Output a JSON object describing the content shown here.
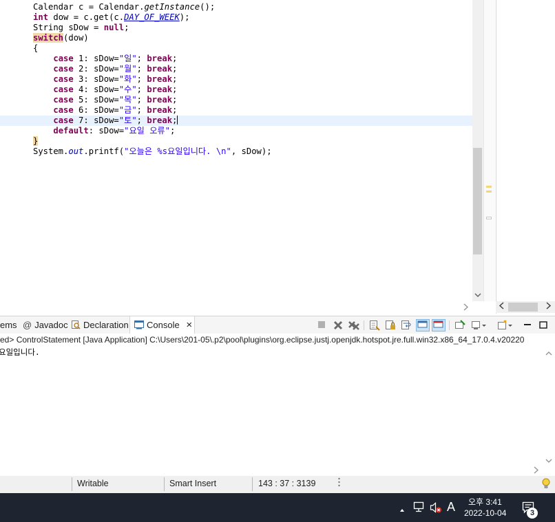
{
  "editor": {
    "lines": [
      {
        "indent": "",
        "tokens": [
          {
            "t": "Calendar c = Calendar."
          },
          {
            "t": "getInstance",
            "c": "it"
          },
          {
            "t": "();"
          }
        ]
      },
      {
        "indent": "",
        "tokens": [
          {
            "t": "int",
            "c": "kw"
          },
          {
            "t": " dow = c.get(c."
          },
          {
            "t": "DAY_OF_WEEK",
            "c": "sf ul"
          },
          {
            "t": ");"
          }
        ]
      },
      {
        "indent": "",
        "tokens": [
          {
            "t": "String sDow = "
          },
          {
            "t": "null",
            "c": "kw"
          },
          {
            "t": ";"
          }
        ]
      },
      {
        "indent": "",
        "tokens": [
          {
            "t": "switch",
            "c": "kw hl"
          },
          {
            "t": "(dow)"
          }
        ]
      },
      {
        "indent": "",
        "tokens": [
          {
            "t": "{"
          }
        ]
      },
      {
        "indent": "    ",
        "tokens": [
          {
            "t": "case",
            "c": "kw"
          },
          {
            "t": " 1: sDow="
          },
          {
            "t": "\"일\"",
            "c": "str"
          },
          {
            "t": "; "
          },
          {
            "t": "break",
            "c": "kw"
          },
          {
            "t": ";"
          }
        ]
      },
      {
        "indent": "    ",
        "tokens": [
          {
            "t": "case",
            "c": "kw"
          },
          {
            "t": " 2: sDow="
          },
          {
            "t": "\"월\"",
            "c": "str"
          },
          {
            "t": "; "
          },
          {
            "t": "break",
            "c": "kw"
          },
          {
            "t": ";"
          }
        ]
      },
      {
        "indent": "    ",
        "tokens": [
          {
            "t": "case",
            "c": "kw"
          },
          {
            "t": " 3: sDow="
          },
          {
            "t": "\"화\"",
            "c": "str"
          },
          {
            "t": "; "
          },
          {
            "t": "break",
            "c": "kw"
          },
          {
            "t": ";"
          }
        ]
      },
      {
        "indent": "    ",
        "tokens": [
          {
            "t": "case",
            "c": "kw"
          },
          {
            "t": " 4: sDow="
          },
          {
            "t": "\"수\"",
            "c": "str"
          },
          {
            "t": "; "
          },
          {
            "t": "break",
            "c": "kw"
          },
          {
            "t": ";"
          }
        ]
      },
      {
        "indent": "    ",
        "tokens": [
          {
            "t": "case",
            "c": "kw"
          },
          {
            "t": " 5: sDow="
          },
          {
            "t": "\"목\"",
            "c": "str"
          },
          {
            "t": "; "
          },
          {
            "t": "break",
            "c": "kw"
          },
          {
            "t": ";"
          }
        ]
      },
      {
        "indent": "    ",
        "tokens": [
          {
            "t": "case",
            "c": "kw"
          },
          {
            "t": " 6: sDow="
          },
          {
            "t": "\"금\"",
            "c": "str"
          },
          {
            "t": "; "
          },
          {
            "t": "break",
            "c": "kw"
          },
          {
            "t": ";"
          }
        ]
      },
      {
        "indent": "    ",
        "tokens": [
          {
            "t": "case",
            "c": "kw"
          },
          {
            "t": " 7: sDow="
          },
          {
            "t": "\"토\"",
            "c": "str"
          },
          {
            "t": "; "
          },
          {
            "t": "break",
            "c": "kw"
          },
          {
            "t": ";"
          }
        ],
        "current": true
      },
      {
        "indent": "    ",
        "tokens": [
          {
            "t": "default",
            "c": "kw"
          },
          {
            "t": ": sDow="
          },
          {
            "t": "\"요일 오류\"",
            "c": "str"
          },
          {
            "t": ";"
          }
        ]
      },
      {
        "indent": "",
        "tokens": [
          {
            "t": "}",
            "c": "hl"
          }
        ]
      },
      {
        "indent": "",
        "tokens": [
          {
            "t": "System."
          },
          {
            "t": "out",
            "c": "sf"
          },
          {
            "t": ".printf("
          },
          {
            "t": "\"오늘은 %s요일입니다. \\n\"",
            "c": "str"
          },
          {
            "t": ", sDow);"
          }
        ]
      }
    ]
  },
  "console": {
    "tabs": [
      {
        "label": "ems",
        "icon": "problems-icon",
        "active": false
      },
      {
        "label": "Javadoc",
        "icon": "javadoc-icon",
        "active": false
      },
      {
        "label": "Declaration",
        "icon": "declaration-icon",
        "active": false
      },
      {
        "label": "Console",
        "icon": "console-icon",
        "active": true
      }
    ],
    "close_glyph": "×",
    "description": "ed> ControlStatement [Java Application] C:\\Users\\201-05\\.p2\\pool\\plugins\\org.eclipse.justj.openjdk.hotspot.jre.full.win32.x86_64_17.0.4.v20220",
    "output": "요일입니다."
  },
  "statusbar": {
    "writable": "Writable",
    "insert_mode": "Smart Insert",
    "position": "143 : 37 : 3139"
  },
  "taskbar": {
    "ime_label": "A",
    "time": "오후 3:41",
    "date": "2022-10-04",
    "notification_count": "3"
  },
  "colors": {
    "keyword": "#7f0055",
    "string": "#2a00ff",
    "static_field": "#0000c0",
    "taskbar": "#1e2530"
  }
}
